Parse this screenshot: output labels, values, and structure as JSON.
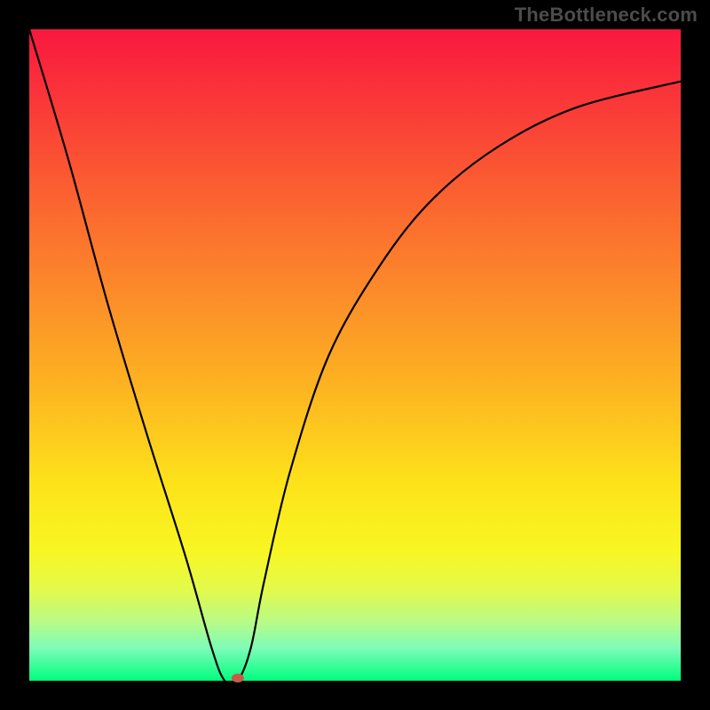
{
  "attribution": "TheBottleneck.com",
  "chart_data": {
    "type": "line",
    "title": "",
    "xlabel": "",
    "ylabel": "",
    "xlim": [
      0,
      100
    ],
    "ylim": [
      0,
      100
    ],
    "grid": false,
    "legend": false,
    "background": "red-yellow-green vertical gradient",
    "series": [
      {
        "name": "bottleneck-curve",
        "x": [
          0,
          6,
          12,
          18,
          24,
          28,
          30,
          32,
          34,
          36,
          40,
          46,
          54,
          62,
          72,
          84,
          100
        ],
        "values": [
          100,
          80,
          58,
          38,
          19,
          5,
          0,
          0,
          5,
          15,
          32,
          50,
          64,
          74,
          82,
          88,
          92
        ]
      }
    ],
    "marker": {
      "x_pct": 32,
      "y_pct": 0
    }
  },
  "gradient_stops": [
    {
      "pct": 0,
      "color": "#f9183f"
    },
    {
      "pct": 12,
      "color": "#fa3a38"
    },
    {
      "pct": 26,
      "color": "#fb6330"
    },
    {
      "pct": 40,
      "color": "#fc8a2a"
    },
    {
      "pct": 55,
      "color": "#fdb421"
    },
    {
      "pct": 70,
      "color": "#fde31a"
    },
    {
      "pct": 80,
      "color": "#f8f622"
    },
    {
      "pct": 86,
      "color": "#e3fa4b"
    },
    {
      "pct": 91,
      "color": "#b7fb87"
    },
    {
      "pct": 95,
      "color": "#7dfcb8"
    },
    {
      "pct": 100,
      "color": "#00fe7e"
    }
  ]
}
